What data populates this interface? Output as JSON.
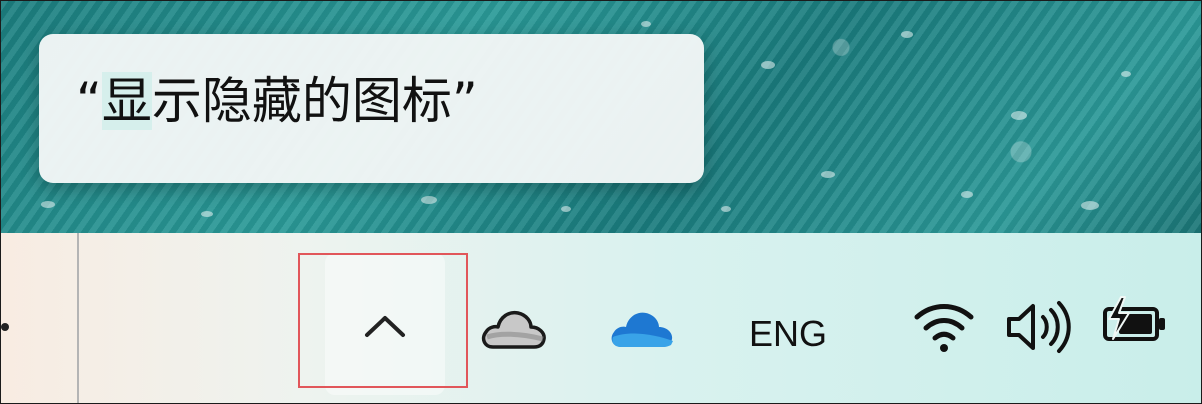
{
  "tooltip": {
    "open_quote": "“",
    "highlight": "显",
    "text": "示隐藏的图标",
    "close_quote": "”"
  },
  "taskbar": {
    "tray_icons": [
      {
        "name": "show-hidden-icons-chevron-icon",
        "interactable": true
      },
      {
        "name": "onedrive-personal-cloud-icon",
        "interactable": true
      },
      {
        "name": "onedrive-business-cloud-icon",
        "interactable": true
      },
      {
        "name": "wifi-icon",
        "interactable": true
      },
      {
        "name": "volume-icon",
        "interactable": true
      },
      {
        "name": "battery-charging-icon",
        "interactable": true
      }
    ],
    "language": "ENG"
  },
  "colors": {
    "highlight_box": "#e1565a",
    "onedrive_blue": "#1e78d2",
    "tooltip_bg": "#f2f6f6"
  }
}
